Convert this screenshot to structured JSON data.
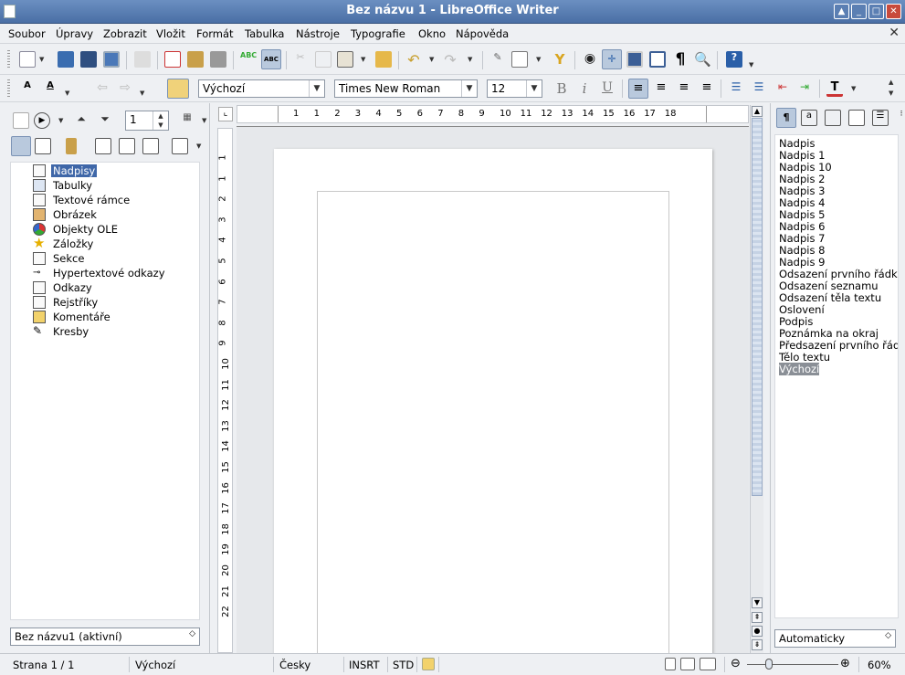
{
  "window": {
    "title": "Bez názvu 1 - LibreOffice Writer"
  },
  "menubar": [
    "Soubor",
    "Úpravy",
    "Zobrazit",
    "Vložit",
    "Formát",
    "Tabulka",
    "Nástroje",
    "Typografie",
    "Okno",
    "Nápověda"
  ],
  "formatting": {
    "paragraph_style": "Výchozí",
    "font_name": "Times New Roman",
    "font_size": "12",
    "bold_glyph": "B",
    "italic_glyph": "i",
    "underline_glyph": "U"
  },
  "navigator": {
    "page_value": "1",
    "items": [
      "Nadpisy",
      "Tabulky",
      "Textové rámce",
      "Obrázek",
      "Objekty OLE",
      "Záložky",
      "Sekce",
      "Hypertextové odkazy",
      "Odkazy",
      "Rejstříky",
      "Komentáře",
      "Kresby"
    ],
    "selected": "Nadpisy",
    "document": "Bez názvu1 (aktivní)"
  },
  "ruler": {
    "h_labels": [
      "1",
      "1",
      "2",
      "3",
      "4",
      "5",
      "6",
      "7",
      "8",
      "9",
      "10",
      "11",
      "12",
      "13",
      "14",
      "15",
      "16",
      "17",
      "18"
    ],
    "v_labels": [
      "1",
      "1",
      "2",
      "3",
      "4",
      "5",
      "6",
      "7",
      "8",
      "9",
      "10",
      "11",
      "12",
      "13",
      "14",
      "15",
      "16",
      "17",
      "18",
      "19",
      "20",
      "21",
      "22"
    ]
  },
  "styles": {
    "items": [
      "Nadpis",
      "Nadpis 1",
      "Nadpis 10",
      "Nadpis 2",
      "Nadpis 3",
      "Nadpis 4",
      "Nadpis 5",
      "Nadpis 6",
      "Nadpis 7",
      "Nadpis 8",
      "Nadpis 9",
      "Odsazení prvního řádku",
      "Odsazení seznamu",
      "Odsazení těla textu",
      "Oslovení",
      "Podpis",
      "Poznámka na okraj",
      "Předsazení prvního řádku",
      "Tělo textu",
      "Výchozí"
    ],
    "selected": "Výchozí",
    "filter": "Automaticky"
  },
  "statusbar": {
    "page": "Strana 1 / 1",
    "style": "Výchozí",
    "language": "Česky",
    "insert_mode": "INSRT",
    "selection_mode": "STD",
    "zoom": "60%"
  },
  "colors": {
    "titlebar": "#4a6fa5",
    "selection": "#3f67a8",
    "accent": "#7b93b5"
  },
  "icons": {
    "toolbar1": [
      "new-icon",
      "save-icon",
      "save-as-icon",
      "export-icon",
      "edit-icon",
      "pdf-icon",
      "print-icon",
      "print-preview-icon",
      "spellcheck-icon",
      "autospell-icon",
      "cut-icon",
      "copy-icon",
      "paste-icon",
      "format-paintbrush-icon",
      "undo-icon",
      "redo-icon",
      "hyperlink-icon",
      "table-icon",
      "font-work-icon",
      "find-icon",
      "navigator-icon",
      "gallery-icon",
      "datasource-icon",
      "pilcrow-icon",
      "zoom-icon",
      "help-icon"
    ]
  }
}
